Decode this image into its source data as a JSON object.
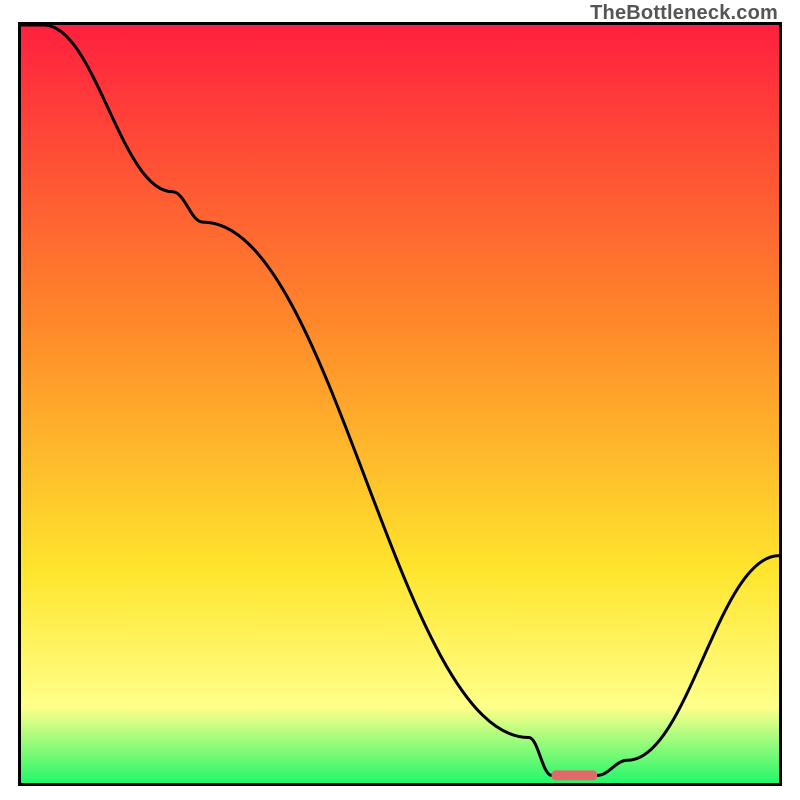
{
  "watermark": "TheBottleneck.com",
  "colors": {
    "gradient_top": "#ff203f",
    "gradient_mid1": "#ff8a2a",
    "gradient_mid2": "#ffe52d",
    "gradient_mid3": "#ffff8a",
    "gradient_bottom": "#23f76a",
    "curve": "#000000",
    "marker": "#e06a6a",
    "frame": "#000000"
  },
  "chart_data": {
    "type": "line",
    "title": "",
    "xlabel": "",
    "ylabel": "",
    "xlim": [
      0,
      100
    ],
    "ylim": [
      0,
      100
    ],
    "x": [
      0,
      3,
      20,
      24,
      67,
      70,
      76,
      80,
      100
    ],
    "values": [
      100,
      100,
      78,
      74,
      6,
      1,
      1,
      3,
      30
    ],
    "marker": {
      "x_start": 70,
      "x_end": 76,
      "y": 1
    },
    "notes": "Curve descends from top-left, inflects near x≈22, reaches a flat minimum around x≈70–76 marked by a short red bar, then rises to the right edge."
  }
}
